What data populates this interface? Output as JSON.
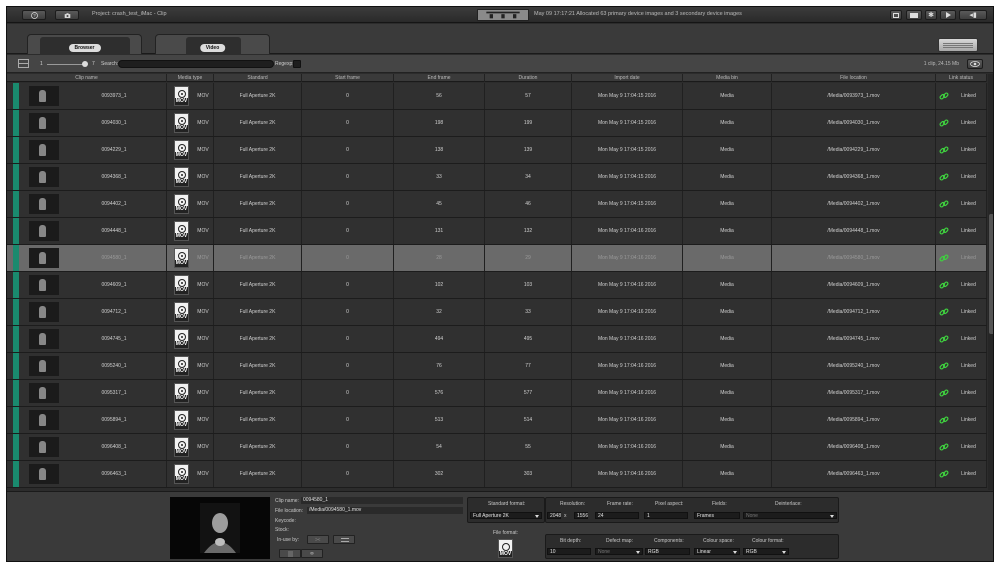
{
  "topbar": {
    "help_icon": "question-icon",
    "camera_icon": "camera-icon",
    "project_title": "Project: crash_test_iMac - Clip",
    "status_message": "May 09 17:17:21 Allocated 63 primary device images and 3 secondary device images"
  },
  "tabs": [
    {
      "label": "Browser"
    },
    {
      "label": "Video"
    }
  ],
  "filter": {
    "zoom_min": "1",
    "zoom_max": "7",
    "search_label": "Search:",
    "search_value": "",
    "regex_label": "Regexp:",
    "clip_count": "1 clip, 24.15 Mb"
  },
  "columns": [
    "Clip name",
    "Media type",
    "Standard",
    "Start frame",
    "End frame",
    "Duration",
    "Import date",
    "Media bin",
    "File location",
    "Link status"
  ],
  "rows": [
    {
      "name": "0093973_1",
      "type": "MOV",
      "standard": "Full Aperture 2K",
      "start": "0",
      "end": "56",
      "duration": "57",
      "date": "Mon May 9 17:04:15 2016",
      "bin": "Media",
      "location": "/Media/0093973_1.mov",
      "link": "Linked"
    },
    {
      "name": "0094030_1",
      "type": "MOV",
      "standard": "Full Aperture 2K",
      "start": "0",
      "end": "198",
      "duration": "199",
      "date": "Mon May 9 17:04:15 2016",
      "bin": "Media",
      "location": "/Media/0094030_1.mov",
      "link": "Linked"
    },
    {
      "name": "0094229_1",
      "type": "MOV",
      "standard": "Full Aperture 2K",
      "start": "0",
      "end": "138",
      "duration": "139",
      "date": "Mon May 9 17:04:15 2016",
      "bin": "Media",
      "location": "/Media/0094229_1.mov",
      "link": "Linked"
    },
    {
      "name": "0094368_1",
      "type": "MOV",
      "standard": "Full Aperture 2K",
      "start": "0",
      "end": "33",
      "duration": "34",
      "date": "Mon May 9 17:04:15 2016",
      "bin": "Media",
      "location": "/Media/0094368_1.mov",
      "link": "Linked"
    },
    {
      "name": "0094402_1",
      "type": "MOV",
      "standard": "Full Aperture 2K",
      "start": "0",
      "end": "45",
      "duration": "46",
      "date": "Mon May 9 17:04:15 2016",
      "bin": "Media",
      "location": "/Media/0094402_1.mov",
      "link": "Linked"
    },
    {
      "name": "0094448_1",
      "type": "MOV",
      "standard": "Full Aperture 2K",
      "start": "0",
      "end": "131",
      "duration": "132",
      "date": "Mon May 9 17:04:16 2016",
      "bin": "Media",
      "location": "/Media/0094448_1.mov",
      "link": "Linked"
    },
    {
      "name": "0094580_1",
      "type": "MOV",
      "standard": "Full Aperture 2K",
      "start": "0",
      "end": "28",
      "duration": "29",
      "date": "Mon May 9 17:04:16 2016",
      "bin": "Media",
      "location": "/Media/0094580_1.mov",
      "link": "Linked",
      "selected": true
    },
    {
      "name": "0094609_1",
      "type": "MOV",
      "standard": "Full Aperture 2K",
      "start": "0",
      "end": "102",
      "duration": "103",
      "date": "Mon May 9 17:04:16 2016",
      "bin": "Media",
      "location": "/Media/0094609_1.mov",
      "link": "Linked"
    },
    {
      "name": "0094712_1",
      "type": "MOV",
      "standard": "Full Aperture 2K",
      "start": "0",
      "end": "32",
      "duration": "33",
      "date": "Mon May 9 17:04:16 2016",
      "bin": "Media",
      "location": "/Media/0094712_1.mov",
      "link": "Linked"
    },
    {
      "name": "0094745_1",
      "type": "MOV",
      "standard": "Full Aperture 2K",
      "start": "0",
      "end": "494",
      "duration": "495",
      "date": "Mon May 9 17:04:16 2016",
      "bin": "Media",
      "location": "/Media/0094745_1.mov",
      "link": "Linked"
    },
    {
      "name": "0095240_1",
      "type": "MOV",
      "standard": "Full Aperture 2K",
      "start": "0",
      "end": "76",
      "duration": "77",
      "date": "Mon May 9 17:04:16 2016",
      "bin": "Media",
      "location": "/Media/0095240_1.mov",
      "link": "Linked"
    },
    {
      "name": "0095317_1",
      "type": "MOV",
      "standard": "Full Aperture 2K",
      "start": "0",
      "end": "576",
      "duration": "577",
      "date": "Mon May 9 17:04:16 2016",
      "bin": "Media",
      "location": "/Media/0095317_1.mov",
      "link": "Linked"
    },
    {
      "name": "0095894_1",
      "type": "MOV",
      "standard": "Full Aperture 2K",
      "start": "0",
      "end": "513",
      "duration": "514",
      "date": "Mon May 9 17:04:16 2016",
      "bin": "Media",
      "location": "/Media/0095894_1.mov",
      "link": "Linked"
    },
    {
      "name": "0096408_1",
      "type": "MOV",
      "standard": "Full Aperture 2K",
      "start": "0",
      "end": "54",
      "duration": "55",
      "date": "Mon May 9 17:04:16 2016",
      "bin": "Media",
      "location": "/Media/0096408_1.mov",
      "link": "Linked"
    },
    {
      "name": "0096463_1",
      "type": "MOV",
      "standard": "Full Aperture 2K",
      "start": "0",
      "end": "302",
      "duration": "303",
      "date": "Mon May 9 17:04:16 2016",
      "bin": "Media",
      "location": "/Media/0096463_1.mov",
      "link": "Linked"
    }
  ],
  "detail": {
    "clip_name_label": "Clip name:",
    "clip_name": "0094580_1",
    "file_location_label": "File location:",
    "file_location": "/Media/0094580_1.mov",
    "keycode_label": "Keycode:",
    "stock_label": "Stock:",
    "in_use_label": "In-use by:",
    "standard_format_label": "Standard format:",
    "standard_format": "Full Aperture 2K",
    "resolution_label": "Resolution:",
    "res_w": "2048",
    "res_x": "x",
    "res_h": "1556",
    "frame_rate_label": "Frame rate:",
    "frame_rate": "24",
    "pixel_aspect_label": "Pixel aspect:",
    "pixel_aspect": "1",
    "fields_label": "Fields:",
    "fields": "Frames",
    "deinterlace_label": "Deinterlace:",
    "deinterlace": "None",
    "file_format_label": "File format:",
    "bit_depth_label": "Bit depth:",
    "bit_depth": "10",
    "defect_map_label": "Defect map:",
    "defect_map": "None",
    "components_label": "Components:",
    "components": "RGB",
    "colour_space_label": "Colour space:",
    "colour_space": "Linear",
    "colour_format_label": "Colour format:",
    "colour_format": "RGB"
  },
  "colors": {
    "accent_green": "#1a8a6e",
    "link_green": "#3fcf3f",
    "selected_row": "#6a6a6a"
  }
}
